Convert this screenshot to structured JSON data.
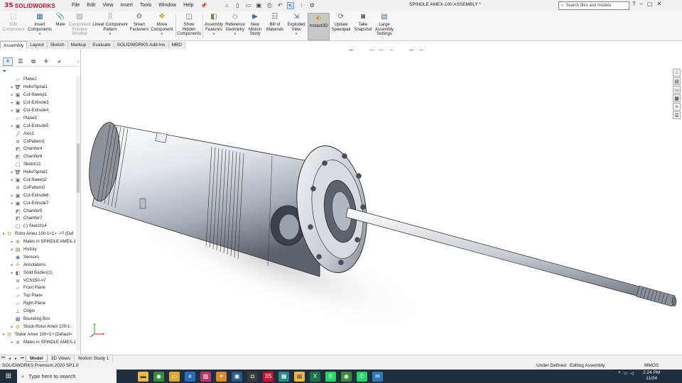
{
  "app": {
    "brand": "SOLIDWORKS",
    "document_title": "SPINDLE AMEX-100 ASSEMBLY *"
  },
  "menu": [
    "File",
    "Edit",
    "View",
    "Insert",
    "Tools",
    "Window",
    "Help"
  ],
  "search": {
    "placeholder": "Search files and models"
  },
  "ribbon": {
    "buttons": [
      {
        "label": "Edit Component",
        "state": "disabled"
      },
      {
        "label": "Insert Components",
        "state": "normal"
      },
      {
        "label": "Mate",
        "state": "normal"
      },
      {
        "label": "Component Preview Window",
        "state": "disabled"
      },
      {
        "label": "Linear Component Pattern",
        "state": "normal"
      },
      {
        "label": "Smart Fasteners",
        "state": "normal"
      },
      {
        "label": "Move Component",
        "state": "normal"
      },
      {
        "label": "Show Hidden Components",
        "state": "normal"
      },
      {
        "label": "Assembly Features",
        "state": "normal"
      },
      {
        "label": "Reference Geometry",
        "state": "normal"
      },
      {
        "label": "New Motion Study",
        "state": "normal"
      },
      {
        "label": "Bill of Materials",
        "state": "normal"
      },
      {
        "label": "Exploded View",
        "state": "normal"
      },
      {
        "label": "Instant3D",
        "state": "active"
      },
      {
        "label": "Update Speedpak",
        "state": "normal"
      },
      {
        "label": "Take Snapshot",
        "state": "normal"
      },
      {
        "label": "Large Assembly Settings",
        "state": "normal"
      }
    ]
  },
  "command_tabs": [
    "Assembly",
    "Layout",
    "Sketch",
    "Markup",
    "Evaluate",
    "SOLIDWORKS Add-Ins",
    "MBD"
  ],
  "tree": {
    "items": [
      {
        "label": "Plane2",
        "icon": "plane-icon",
        "expand": ""
      },
      {
        "label": "Helix/Spiral1",
        "icon": "helix-icon",
        "expand": "▸"
      },
      {
        "label": "Cut-Sweep1",
        "icon": "cut-icon",
        "expand": "▸"
      },
      {
        "label": "Cut-Extrude3",
        "icon": "cut-icon",
        "expand": "▸"
      },
      {
        "label": "Cut-Extrude4",
        "icon": "cut-icon",
        "expand": "▸"
      },
      {
        "label": "Plane3",
        "icon": "plane-icon",
        "expand": ""
      },
      {
        "label": "Cut-Extrude5",
        "icon": "cut-icon",
        "expand": "▸"
      },
      {
        "label": "Axis1",
        "icon": "axis-icon",
        "expand": ""
      },
      {
        "label": "CirPattern1",
        "icon": "pattern-icon",
        "expand": ""
      },
      {
        "label": "Chamfer4",
        "icon": "chamfer-icon",
        "expand": ""
      },
      {
        "label": "Chamfer6",
        "icon": "chamfer-icon",
        "expand": ""
      },
      {
        "label": "Sketch11",
        "icon": "sketch-icon",
        "expand": ""
      },
      {
        "label": "Helix/Spiral2",
        "icon": "helix-icon",
        "expand": "▸"
      },
      {
        "label": "Cut-Sweep2",
        "icon": "cut-icon",
        "expand": "▸"
      },
      {
        "label": "CirPattern2",
        "icon": "pattern-icon",
        "expand": ""
      },
      {
        "label": "Cut-Extrude6",
        "icon": "cut-icon",
        "expand": "▸"
      },
      {
        "label": "Cut-Extrude7",
        "icon": "cut-icon",
        "expand": "▸"
      },
      {
        "label": "Chamfer5",
        "icon": "chamfer-icon",
        "expand": ""
      },
      {
        "label": "Chamfer7",
        "icon": "chamfer-icon",
        "expand": ""
      },
      {
        "label": "(-) Sketch14",
        "icon": "sketch-icon",
        "expand": ""
      },
      {
        "label": "Rotor Amex 100-1<1> ->? (Def",
        "icon": "part-icon",
        "expand": "▾",
        "level": 0
      },
      {
        "label": "Mates in SPINDLE AMEX-1",
        "icon": "mates-icon",
        "expand": "▸"
      },
      {
        "label": "History",
        "icon": "history-icon",
        "expand": "▸"
      },
      {
        "label": "Sensors",
        "icon": "sensor-icon",
        "expand": ""
      },
      {
        "label": "Annotations",
        "icon": "annotation-icon",
        "expand": "▸"
      },
      {
        "label": "Solid Bodies(1)",
        "icon": "solid-bodies-icon",
        "expand": "▸"
      },
      {
        "label": "VCN150->?",
        "icon": "material-icon",
        "expand": ""
      },
      {
        "label": "Front Plane",
        "icon": "plane-icon",
        "expand": ""
      },
      {
        "label": "Top Plane",
        "icon": "plane-icon",
        "expand": ""
      },
      {
        "label": "Right Plane",
        "icon": "plane-icon",
        "expand": ""
      },
      {
        "label": "Origin",
        "icon": "origin-icon",
        "expand": ""
      },
      {
        "label": "Bounding Box",
        "icon": "bounding-box-icon",
        "expand": ""
      },
      {
        "label": "Stock-Rotor Amex 100-1-",
        "icon": "part-icon",
        "expand": "▸"
      },
      {
        "label": "Stator Amex 100<1> (Default<",
        "icon": "part-icon",
        "expand": "▾",
        "level": 0
      },
      {
        "label": "Mates in SPINDLE AMEX-1",
        "icon": "mates-icon",
        "expand": "▸"
      }
    ]
  },
  "bottom_tabs": [
    "Model",
    "3D Views",
    "Motion Study 1"
  ],
  "status": {
    "version": "SOLIDWORKS Premium 2020 SP1.0",
    "definition": "Under Defined",
    "mode": "Editing Assembly",
    "units": "MMGS"
  },
  "taskbar": {
    "search_placeholder": "Type here to search",
    "time": "2:24 PM",
    "date": "11/24"
  },
  "colors": {
    "brand_red": "#c8102e",
    "taskbar": "#1f2f3f",
    "ribbon_bg": "#f7f7f7",
    "active_button": "#c8c8c8"
  }
}
